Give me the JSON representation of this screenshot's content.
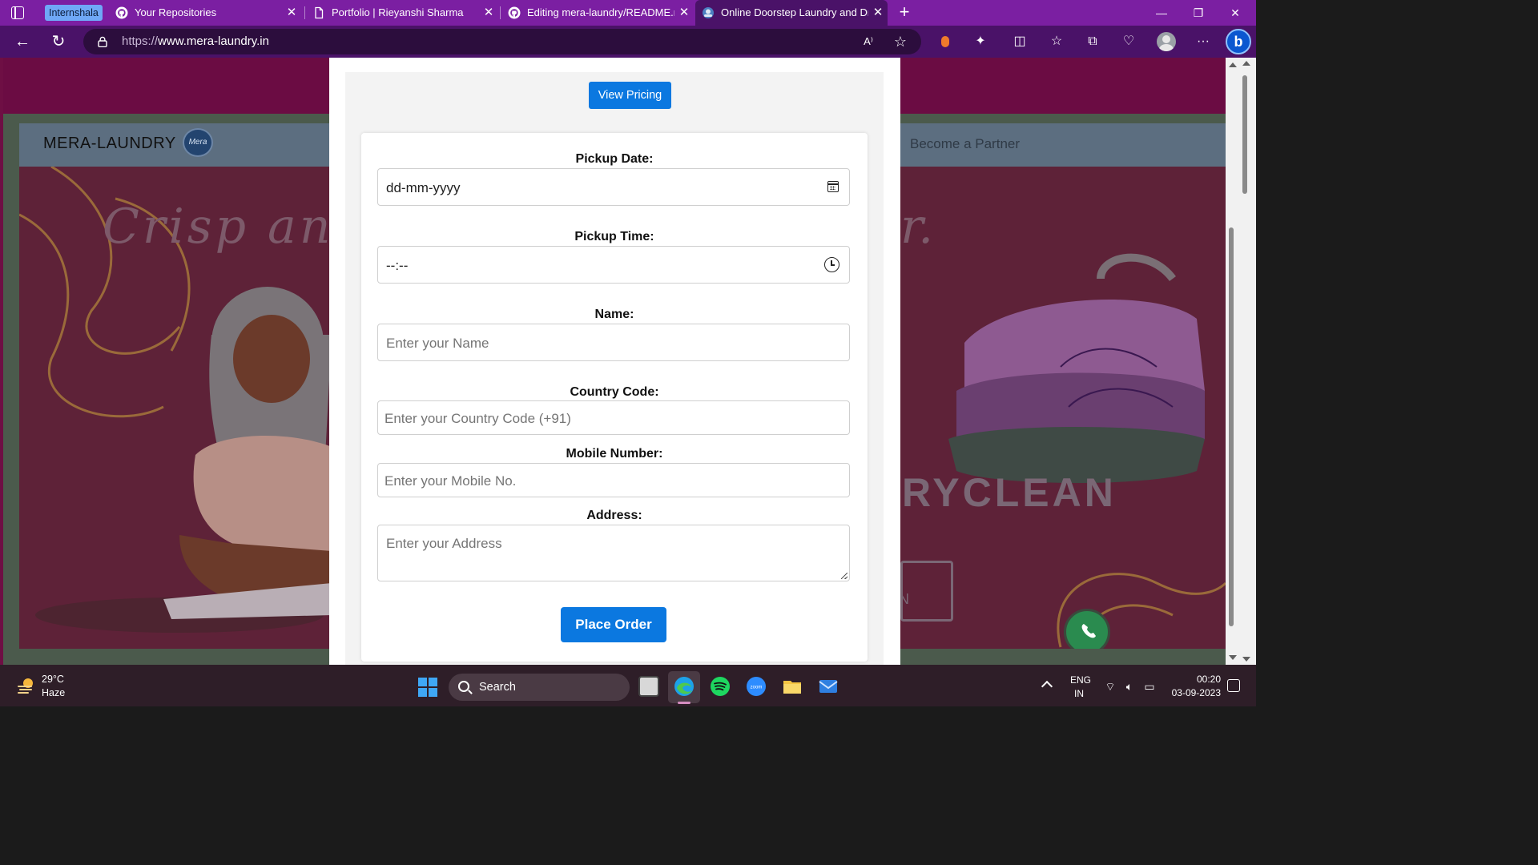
{
  "browser": {
    "tab_group_label": "Internshala",
    "tabs": [
      {
        "title": "Your Repositories",
        "icon": "github-icon"
      },
      {
        "title": "Portfolio | Rieyanshi Sharma",
        "icon": "page-icon"
      },
      {
        "title": "Editing mera-laundry/README.m",
        "icon": "github-icon"
      },
      {
        "title": "Online Doorstep Laundry and Dr",
        "icon": "site-icon",
        "active": true
      }
    ],
    "url_scheme": "https://",
    "url_host": "www.mera-laundry.in",
    "theme_color": "#7b1fa2"
  },
  "site": {
    "logo_text": "MERA-LAUNDRY",
    "logo_badge": "Mera",
    "nav_link": "Become a Partner",
    "hero_tagline_left": "Crisp an",
    "hero_tagline_right": "r.",
    "hero_service": "RYCLEAN",
    "hero_footer_fragment": "N"
  },
  "modal": {
    "pricing_button": "View Pricing",
    "fields": {
      "pickup_date": {
        "label": "Pickup Date:",
        "value": "dd-mm-yyyy"
      },
      "pickup_time": {
        "label": "Pickup Time:",
        "value": "--:--"
      },
      "name": {
        "label": "Name:",
        "placeholder": "Enter your Name"
      },
      "country_code": {
        "label": "Country Code:",
        "placeholder": "Enter your Country Code (+91)"
      },
      "mobile": {
        "label": "Mobile Number:",
        "placeholder": "Enter your Mobile No."
      },
      "address": {
        "label": "Address:",
        "placeholder": "Enter your Address"
      }
    },
    "submit_button": "Place Order",
    "accent_color": "#0b78e0"
  },
  "taskbar": {
    "weather_temp": "29°C",
    "weather_condition": "Haze",
    "search_label": "Search",
    "lang_line1": "ENG",
    "lang_line2": "IN",
    "time": "00:20",
    "date": "03-09-2023"
  }
}
